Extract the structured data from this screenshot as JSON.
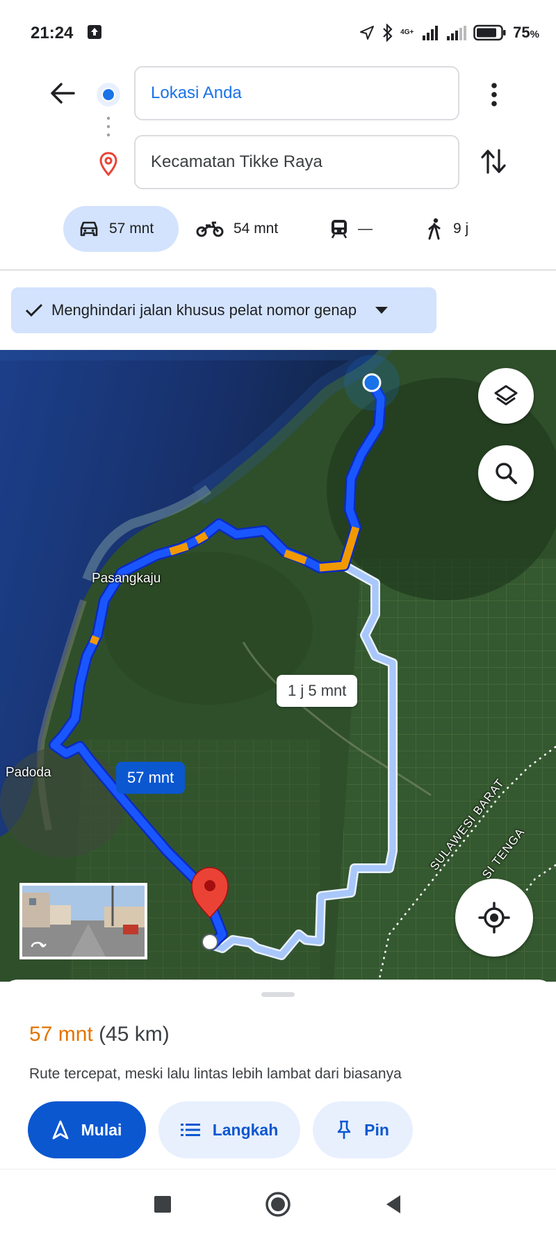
{
  "status_bar": {
    "time": "21:24",
    "battery_percent": "75",
    "battery_suffix": "%",
    "network_label": "4G+",
    "icons": [
      "upload-icon",
      "location-arrow-icon",
      "bluetooth-icon",
      "signal-icon",
      "signal-icon",
      "battery-icon"
    ]
  },
  "directions": {
    "origin": "Lokasi Anda",
    "destination": "Kecamatan Tikke Raya"
  },
  "modes": [
    {
      "name": "drive",
      "icon": "car-icon",
      "label": "57 mnt",
      "active": true
    },
    {
      "name": "motorcycle",
      "icon": "motorcycle-icon",
      "label": "54 mnt"
    },
    {
      "name": "transit",
      "icon": "train-icon",
      "label": "—"
    },
    {
      "name": "walk",
      "icon": "walk-icon",
      "label": "9 j"
    }
  ],
  "filter_chip": {
    "label": "Menghindari jalan khusus pelat nomor genap",
    "icon": "check-icon"
  },
  "map": {
    "labels": {
      "pasangkaju": "Pasangkaju",
      "padoda": "Padoda",
      "region": "SULAWESI BARAT",
      "region2": "SI TENGA"
    },
    "eta_alt": "1 j 5 mnt",
    "eta_main": "57 mnt",
    "colors": {
      "route_main": "#1a56ff",
      "route_alt": "#a8c7fa",
      "traffic_slow": "#f29900",
      "pin": "#ea4335"
    }
  },
  "route_summary": {
    "duration": "57 mnt",
    "distance": "(45 km)",
    "description": "Rute tercepat, meski lalu lintas lebih lambat dari biasanya",
    "accent_color": "#e37400"
  },
  "actions": {
    "start": "Mulai",
    "steps": "Langkah",
    "pin": "Pin"
  }
}
